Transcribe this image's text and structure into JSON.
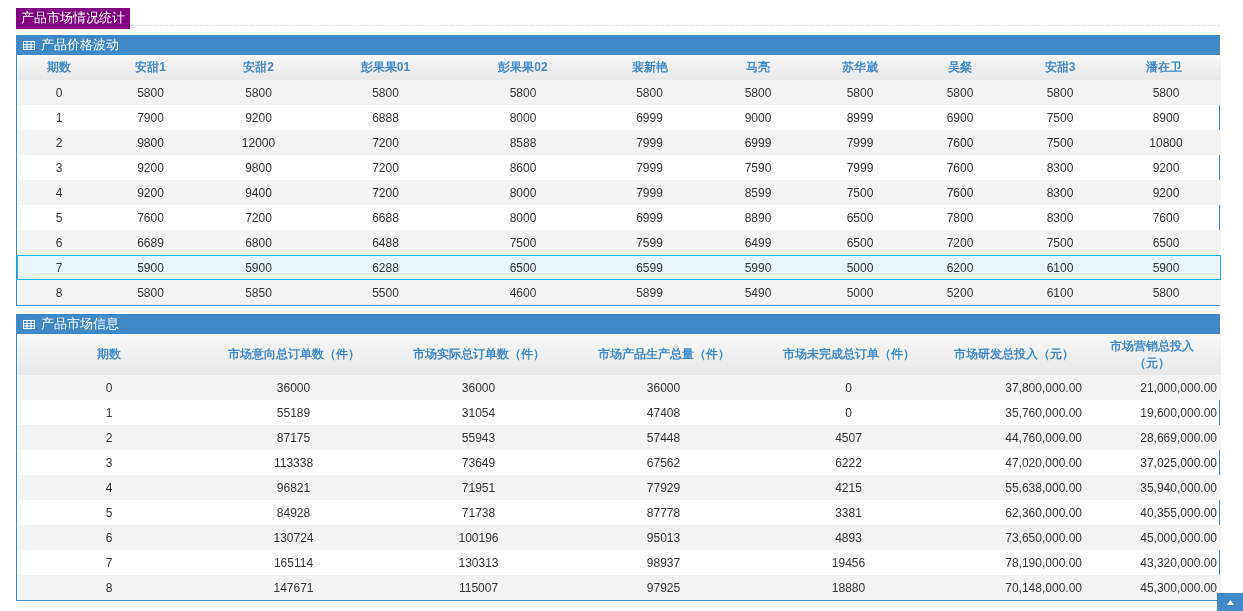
{
  "page_title": "产品市场情况统计",
  "panels": [
    {
      "title": "产品价格波动",
      "columns": [
        "期数",
        "安甜1",
        "安甜2",
        "彭果果01",
        "彭果果02",
        "裴新艳",
        "马亮",
        "苏华崴",
        "吴粲",
        "安甜3",
        "潘在卫"
      ],
      "rows": [
        {
          "selected": false,
          "cells": [
            "0",
            "5800",
            "5800",
            "5800",
            "5800",
            "5800",
            "5800",
            "5800",
            "5800",
            "5800",
            "5800"
          ]
        },
        {
          "selected": false,
          "cells": [
            "1",
            "7900",
            "9200",
            "6888",
            "8000",
            "6999",
            "9000",
            "8999",
            "6900",
            "7500",
            "8900"
          ]
        },
        {
          "selected": false,
          "cells": [
            "2",
            "9800",
            "12000",
            "7200",
            "8588",
            "7999",
            "6999",
            "7999",
            "7600",
            "7500",
            "10800"
          ]
        },
        {
          "selected": false,
          "cells": [
            "3",
            "9200",
            "9800",
            "7200",
            "8600",
            "7999",
            "7590",
            "7999",
            "7600",
            "8300",
            "9200"
          ]
        },
        {
          "selected": false,
          "cells": [
            "4",
            "9200",
            "9400",
            "7200",
            "8000",
            "7999",
            "8599",
            "7500",
            "7600",
            "8300",
            "9200"
          ]
        },
        {
          "selected": false,
          "cells": [
            "5",
            "7600",
            "7200",
            "6688",
            "8000",
            "6999",
            "8890",
            "6500",
            "7800",
            "8300",
            "7600"
          ]
        },
        {
          "selected": false,
          "cells": [
            "6",
            "6689",
            "6800",
            "6488",
            "7500",
            "7599",
            "6499",
            "6500",
            "7200",
            "7500",
            "6500"
          ]
        },
        {
          "selected": true,
          "cells": [
            "7",
            "5900",
            "5900",
            "6288",
            "6500",
            "6599",
            "5990",
            "5000",
            "6200",
            "6100",
            "5900"
          ]
        },
        {
          "selected": false,
          "cells": [
            "8",
            "5800",
            "5850",
            "5500",
            "4600",
            "5899",
            "5490",
            "5000",
            "5200",
            "6100",
            "5800"
          ]
        }
      ]
    },
    {
      "title": "产品市场信息",
      "columns": [
        "期数",
        "市场意向总订单数（件）",
        "市场实际总订单数（件）",
        "市场产品生产总量（件）",
        "市场未完成总订单（件）",
        "市场研发总投入（元）",
        "市场营销总投入（元）"
      ],
      "rows": [
        {
          "selected": false,
          "cells": [
            "0",
            "36000",
            "36000",
            "36000",
            "0",
            "37,800,000.00",
            "21,000,000.00"
          ]
        },
        {
          "selected": false,
          "cells": [
            "1",
            "55189",
            "31054",
            "47408",
            "0",
            "35,760,000.00",
            "19,600,000.00"
          ]
        },
        {
          "selected": false,
          "cells": [
            "2",
            "87175",
            "55943",
            "57448",
            "4507",
            "44,760,000.00",
            "28,669,000.00"
          ]
        },
        {
          "selected": false,
          "cells": [
            "3",
            "113338",
            "73649",
            "67562",
            "6222",
            "47,020,000.00",
            "37,025,000.00"
          ]
        },
        {
          "selected": false,
          "cells": [
            "4",
            "96821",
            "71951",
            "77929",
            "4215",
            "55,638,000.00",
            "35,940,000.00"
          ]
        },
        {
          "selected": false,
          "cells": [
            "5",
            "84928",
            "71738",
            "87778",
            "3381",
            "62,360,000.00",
            "40,355,000.00"
          ]
        },
        {
          "selected": false,
          "cells": [
            "6",
            "130724",
            "100196",
            "95013",
            "4893",
            "73,650,000.00",
            "45,000,000.00"
          ]
        },
        {
          "selected": false,
          "cells": [
            "7",
            "165114",
            "130313",
            "98937",
            "19456",
            "78,190,000.00",
            "43,320,000.00"
          ]
        },
        {
          "selected": false,
          "cells": [
            "8",
            "147671",
            "115007",
            "97925",
            "18880",
            "70,148,000.00",
            "45,300,000.00"
          ]
        }
      ]
    }
  ]
}
